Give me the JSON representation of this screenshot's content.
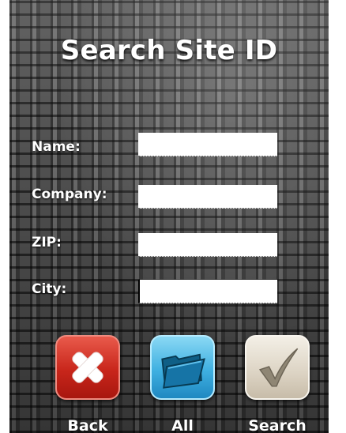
{
  "header": {
    "title": "Search Site ID"
  },
  "form": {
    "name": {
      "label": "Name:",
      "value": ""
    },
    "company": {
      "label": "Company:",
      "value": ""
    },
    "zip": {
      "label": "ZIP:",
      "value": ""
    },
    "city": {
      "label": "City:",
      "value": ""
    }
  },
  "buttons": {
    "back": {
      "label": "Back",
      "icon": "close-x-icon",
      "color": "#c8261b"
    },
    "all": {
      "label": "All",
      "icon": "folder-icon",
      "color": "#3fb0e1"
    },
    "search": {
      "label": "Search",
      "icon": "checkmark-icon",
      "color": "#dcd3c3"
    }
  }
}
